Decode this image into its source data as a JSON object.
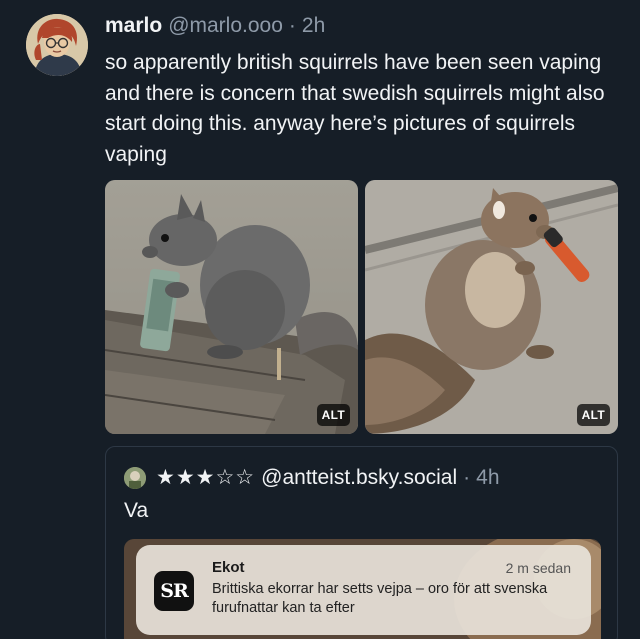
{
  "post": {
    "display_name": "marlo",
    "handle": "@marlo.ooo",
    "separator": "·",
    "time": "2h",
    "text": "so apparently british squirrels have been seen vaping and there is concern that swedish squirrels might also start doing this. anyway here’s pictures of squirrels vaping",
    "images": [
      {
        "alt_badge": "ALT"
      },
      {
        "alt_badge": "ALT"
      }
    ]
  },
  "quote": {
    "stars": "★★★☆☆",
    "handle": "@antteist.bsky.social",
    "separator": "·",
    "time": "4h",
    "text": "Va",
    "notification": {
      "icon_text": "SR",
      "app": "Ekot",
      "time": "2 m sedan",
      "body": "Brittiska ekorrar har setts vejpa – oro för att svenska furufnattar kan ta efter"
    }
  },
  "colors": {
    "background": "#161e27",
    "text": "#f1f3f5",
    "muted": "#8e9aa8",
    "border": "#2d3845"
  }
}
